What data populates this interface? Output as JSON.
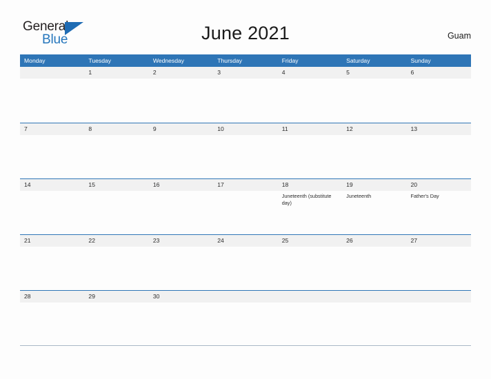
{
  "brand": {
    "name_part1": "General",
    "name_part2": "Blue",
    "triangle_color": "#1f6cb4",
    "text_color": "#231f20",
    "blue_text_color": "#2576bc"
  },
  "header": {
    "title": "June 2021",
    "location": "Guam"
  },
  "colors": {
    "header_blue": "#2e75b6",
    "date_strip_gray": "#f1f1f1",
    "page_background": "#fdfdfd",
    "text_dark": "#2b2b2b"
  },
  "calendar": {
    "weekdays": [
      "Monday",
      "Tuesday",
      "Wednesday",
      "Thursday",
      "Friday",
      "Saturday",
      "Sunday"
    ],
    "weeks": [
      {
        "days": [
          {
            "number": "",
            "events": []
          },
          {
            "number": "1",
            "events": []
          },
          {
            "number": "2",
            "events": []
          },
          {
            "number": "3",
            "events": []
          },
          {
            "number": "4",
            "events": []
          },
          {
            "number": "5",
            "events": []
          },
          {
            "number": "6",
            "events": []
          }
        ]
      },
      {
        "days": [
          {
            "number": "7",
            "events": []
          },
          {
            "number": "8",
            "events": []
          },
          {
            "number": "9",
            "events": []
          },
          {
            "number": "10",
            "events": []
          },
          {
            "number": "11",
            "events": []
          },
          {
            "number": "12",
            "events": []
          },
          {
            "number": "13",
            "events": []
          }
        ]
      },
      {
        "days": [
          {
            "number": "14",
            "events": []
          },
          {
            "number": "15",
            "events": []
          },
          {
            "number": "16",
            "events": []
          },
          {
            "number": "17",
            "events": []
          },
          {
            "number": "18",
            "events": [
              "Juneteenth (substitute day)"
            ]
          },
          {
            "number": "19",
            "events": [
              "Juneteenth"
            ]
          },
          {
            "number": "20",
            "events": [
              "Father's Day"
            ]
          }
        ]
      },
      {
        "days": [
          {
            "number": "21",
            "events": []
          },
          {
            "number": "22",
            "events": []
          },
          {
            "number": "23",
            "events": []
          },
          {
            "number": "24",
            "events": []
          },
          {
            "number": "25",
            "events": []
          },
          {
            "number": "26",
            "events": []
          },
          {
            "number": "27",
            "events": []
          }
        ]
      },
      {
        "days": [
          {
            "number": "28",
            "events": []
          },
          {
            "number": "29",
            "events": []
          },
          {
            "number": "30",
            "events": []
          },
          {
            "number": "",
            "events": []
          },
          {
            "number": "",
            "events": []
          },
          {
            "number": "",
            "events": []
          },
          {
            "number": "",
            "events": []
          }
        ]
      }
    ]
  }
}
